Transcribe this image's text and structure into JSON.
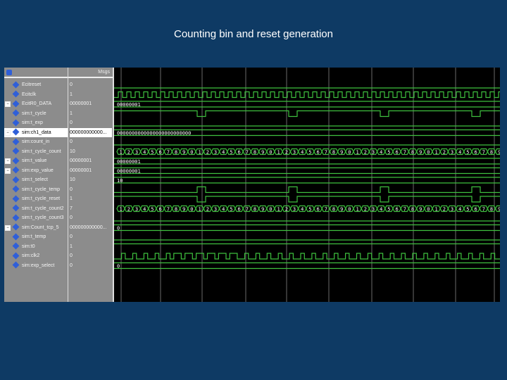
{
  "title": "Counting bin and reset generation",
  "header": {
    "value_col": "Msgs"
  },
  "colors": {
    "wave": "#3ec03e",
    "grid": "#6a6a6a",
    "bus_text": "#ffffff"
  },
  "signals": [
    {
      "name": "Ecitreset",
      "value": "0",
      "wave": "low"
    },
    {
      "name": "Ecitclk",
      "value": "1",
      "wave": "clock"
    },
    {
      "name": "EcitR0_DATA",
      "value": "00000001",
      "wave": "bus",
      "bus": "00000001",
      "expand": true
    },
    {
      "name": "sim:t_cycle",
      "value": "1",
      "wave": "highdip"
    },
    {
      "name": "sim:t_exp",
      "value": "0",
      "wave": "low"
    },
    {
      "name": "sim:ch1_data",
      "value": "000000000000...",
      "wave": "bus",
      "bus": "0000000000000000000000000",
      "expand": true,
      "selected": true
    },
    {
      "name": "sim:count_in",
      "value": "0",
      "wave": "low"
    },
    {
      "name": "sim:t_cycle_count",
      "value": "10",
      "wave": "counter"
    },
    {
      "name": "sim:t_value",
      "value": "00000001",
      "wave": "bus",
      "bus": "00000001",
      "expand": true
    },
    {
      "name": "sim:exp_value",
      "value": "00000001",
      "wave": "bus",
      "bus": "00000001",
      "expand": true
    },
    {
      "name": "sim:t_select",
      "value": "10",
      "wave": "bus",
      "bus": "10"
    },
    {
      "name": "sim:t_cycle_temp",
      "value": "0",
      "wave": "lowpulse"
    },
    {
      "name": "sim:t_cycle_reset",
      "value": "1",
      "wave": "highdip"
    },
    {
      "name": "sim:t_cycle_count2",
      "value": "7",
      "wave": "counter"
    },
    {
      "name": "sim:t_cycle_count3",
      "value": "0",
      "wave": "low"
    },
    {
      "name": "sim:Count_tcp_5",
      "value": "000000000000...",
      "wave": "bus",
      "bus": "0",
      "expand": true
    },
    {
      "name": "sim:t_temp",
      "value": "0",
      "wave": "low"
    },
    {
      "name": "sim:t0",
      "value": "1",
      "wave": "high"
    },
    {
      "name": "sim:clk2",
      "value": "0",
      "wave": "clock2"
    },
    {
      "name": "sim:exp_select",
      "value": "0",
      "wave": "bus",
      "bus": "0"
    }
  ],
  "counter_labels": [
    "1",
    "2",
    "3",
    "4",
    "5",
    "6",
    "7",
    "8",
    "9",
    "0"
  ]
}
